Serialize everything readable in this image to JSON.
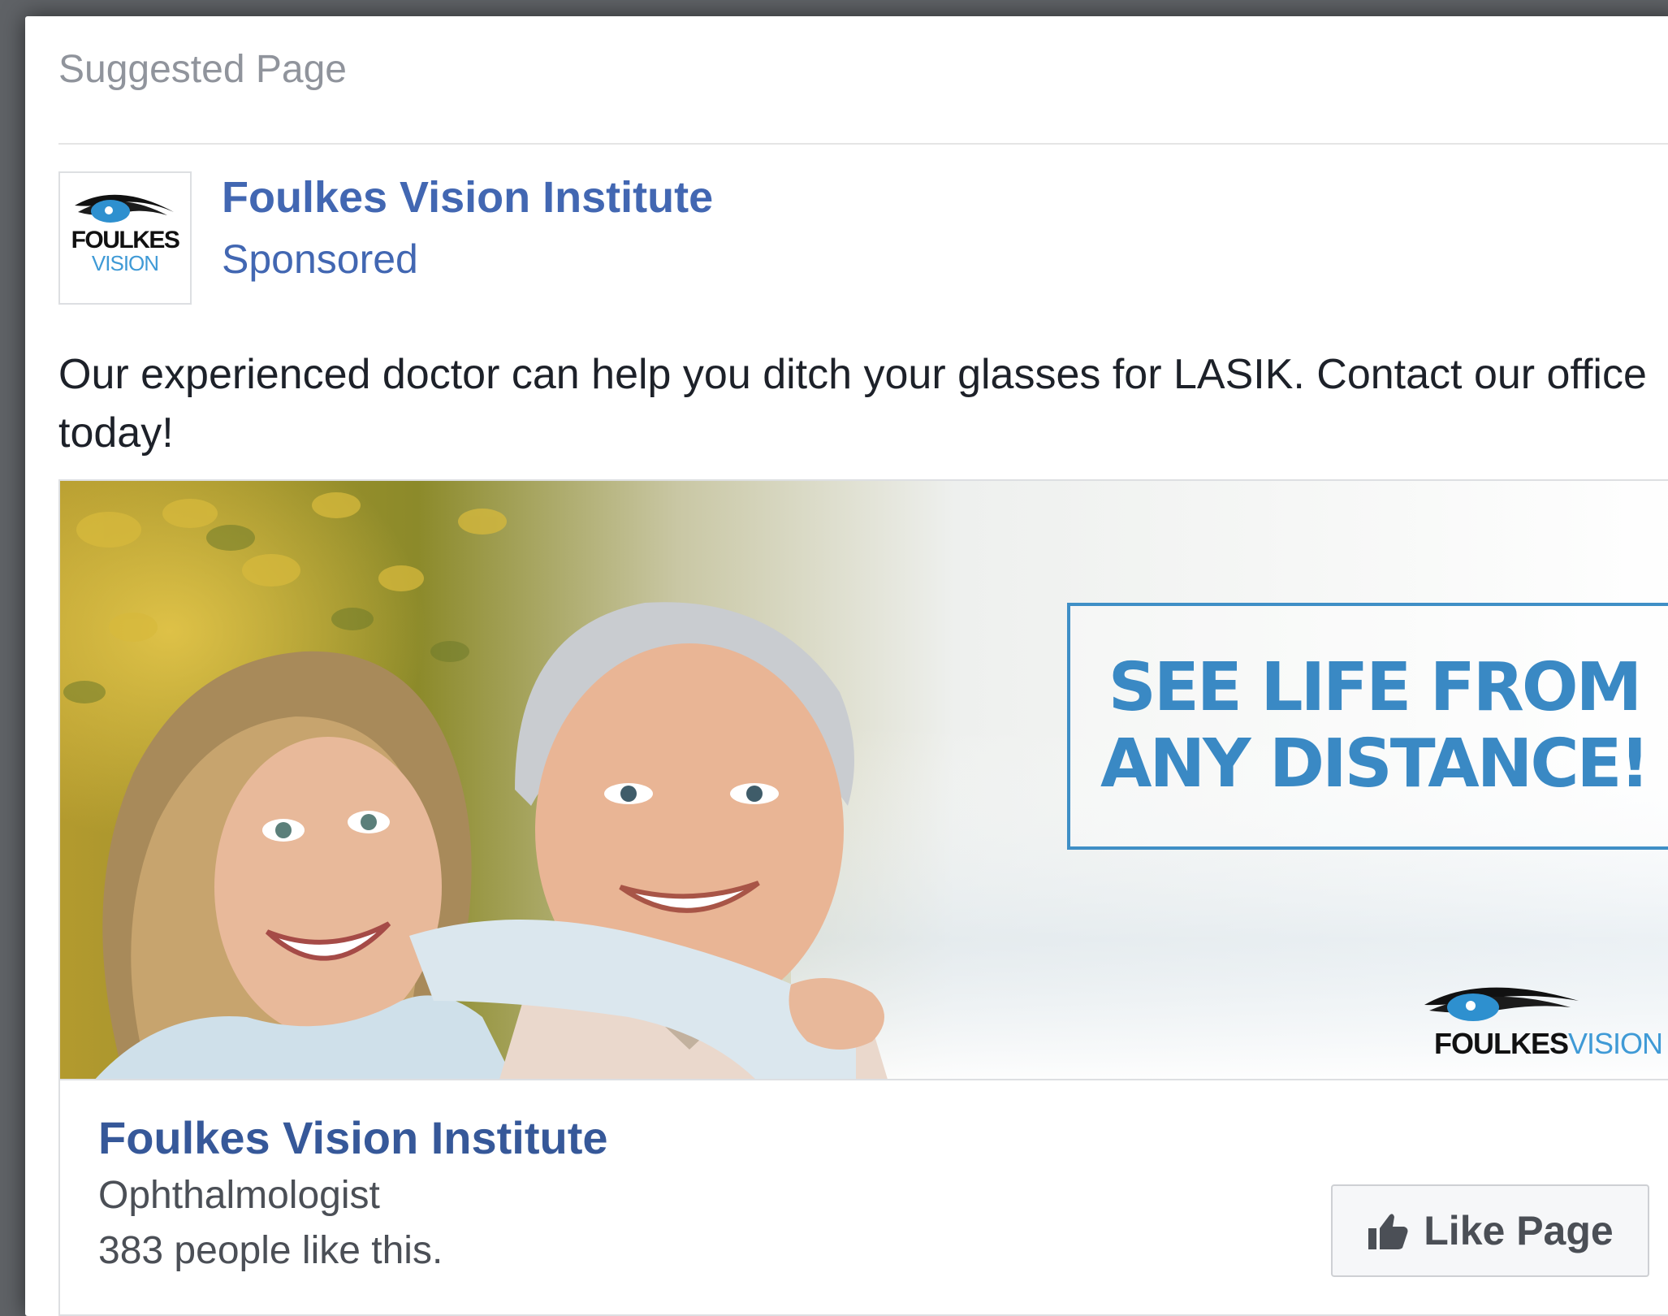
{
  "header": {
    "label": "Suggested Page"
  },
  "page": {
    "name": "Foulkes Vision Institute",
    "sponsored_label": "Sponsored",
    "avatar_logo": {
      "text_top": "FOULKES",
      "text_bottom": "VISION"
    }
  },
  "post": {
    "text": "Our experienced doctor can help you ditch your glasses for LASIK. Contact our office today!"
  },
  "ad_image": {
    "tagline_line1": "SEE LIFE FROM",
    "tagline_line2": "ANY DISTANCE!",
    "logo_text_bold": "FOULKES",
    "logo_text_light": "VISION"
  },
  "link_card": {
    "title": "Foulkes Vision Institute",
    "category": "Ophthalmologist",
    "likes": "383 people like this.",
    "like_button_label": "Like Page",
    "like_icon": "thumbs-up-icon"
  },
  "colors": {
    "link_blue": "#4267b2",
    "tagline_blue": "#3a89c4",
    "logo_blue": "#3f9ad6"
  }
}
